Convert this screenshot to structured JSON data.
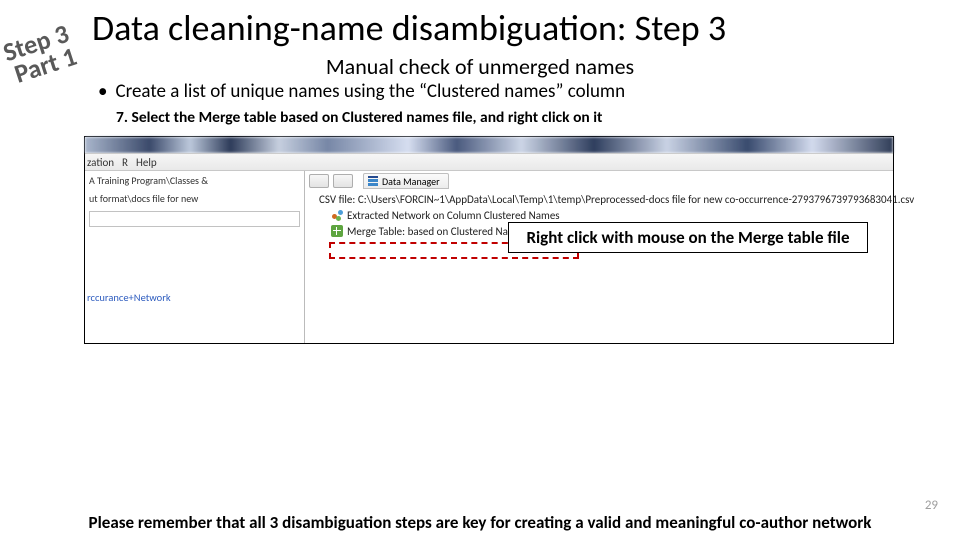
{
  "stamp": {
    "line1": "Step 3",
    "line2": "Part 1"
  },
  "title": "Data cleaning-name disambiguation: Step 3",
  "subtitle": "Manual check of unmerged names",
  "bullet": "Create a list of unique names using the “Clustered names” column",
  "step7_prefix": "7. ",
  "step7_text": "Select the Merge table based on Clustered names file, and right click on it",
  "screenshot": {
    "menu": {
      "truncated": "zation",
      "items": [
        "R",
        "Help"
      ]
    },
    "dm_tab": "Data Manager",
    "left_crumb1": "A Training Program\\Classes &",
    "left_crumb2": "ut format\\docs file for new",
    "left_link": "rccurance+Network",
    "tree": {
      "csv": "CSV file: C:\\Users\\FORCIN~1\\AppData\\Local\\Temp\\1\\temp\\Preprocessed-docs file for new co-occurrence-2793796739793683041.csv",
      "net": "Extracted Network on Column Clustered Names",
      "merge": "Merge Table: based on Clustered Names"
    }
  },
  "callout": "Right click with mouse on the Merge table file",
  "footer": "Please remember that all 3 disambiguation steps are key for creating a valid and meaningful co-author network",
  "page_number": "29"
}
